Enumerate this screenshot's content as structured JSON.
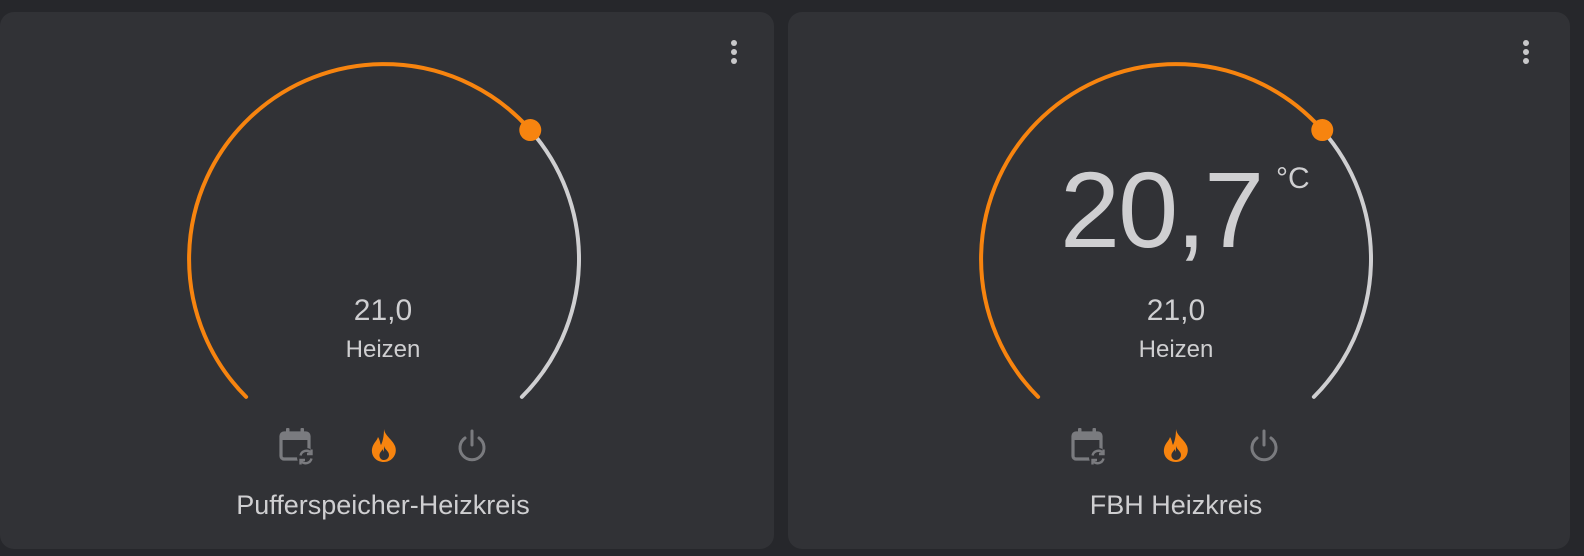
{
  "colors": {
    "background": "#26272b",
    "card": "#313236",
    "accent_heat": "#f7840f",
    "track": "#cfcfd1",
    "icon_inactive": "#7a7b7f",
    "text": "#cfcfd1"
  },
  "cards": [
    {
      "name": "Pufferspeicher-Heizkreis",
      "current_temperature": "",
      "unit": "",
      "target_temperature": "21,0",
      "hvac_action": "Heizen",
      "setpoint_fraction": 0.68,
      "modes": [
        {
          "icon": "calendar-sync-icon",
          "active": false
        },
        {
          "icon": "fire-icon",
          "active": true
        },
        {
          "icon": "power-icon",
          "active": false
        }
      ],
      "menu_icon": "dots-vertical-icon"
    },
    {
      "name": "FBH Heizkreis",
      "current_temperature": "20,7",
      "unit": "°C",
      "target_temperature": "21,0",
      "hvac_action": "Heizen",
      "setpoint_fraction": 0.68,
      "modes": [
        {
          "icon": "calendar-sync-icon",
          "active": false
        },
        {
          "icon": "fire-icon",
          "active": true
        },
        {
          "icon": "power-icon",
          "active": false
        }
      ],
      "menu_icon": "dots-vertical-icon"
    }
  ]
}
